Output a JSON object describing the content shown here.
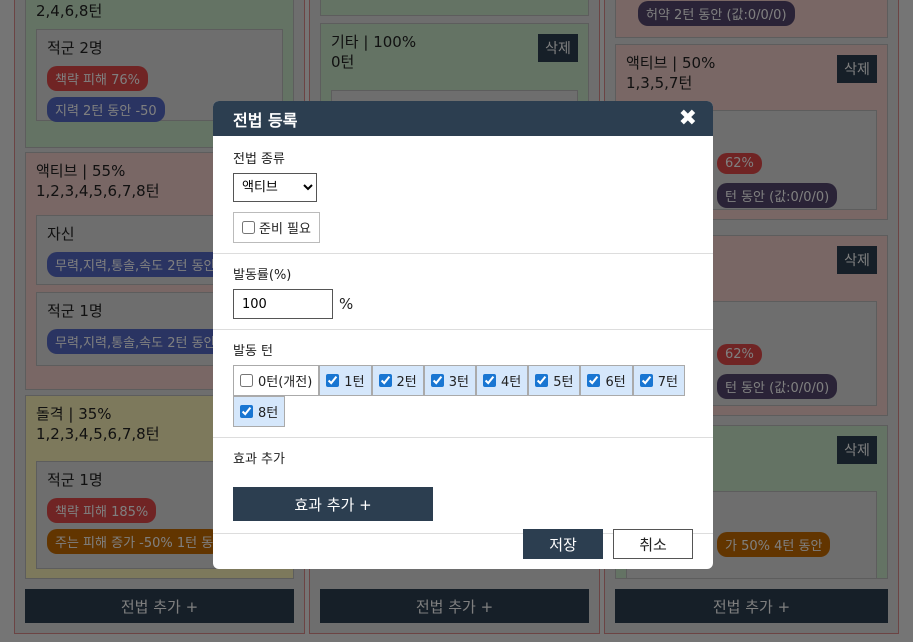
{
  "background": {
    "col1": {
      "tactic_top": {
        "turns": "2,4,6,8턴",
        "target_label": "적군 2명",
        "effects": [
          "책략 피해 76%",
          "지력 2턴 동안 -50"
        ]
      },
      "tactic_active": {
        "title": "액티브 | 55%",
        "turns": "1,2,3,4,5,6,7,8턴",
        "target1": "자신",
        "target1_effect": "무력,지력,통솔,속도 2턴 동안",
        "target2": "적군 1명",
        "target2_effect": "무력,지력,통솔,속도 2턴 동안"
      },
      "tactic_charge": {
        "title": "돌격 | 35%",
        "turns": "1,2,3,4,5,6,7,8턴",
        "target": "적군 1명",
        "effects": [
          "책략 피해 185%",
          "주는 피해 증가 -50% 1턴 동"
        ]
      }
    },
    "col2": {
      "tactic": {
        "title": "기타 | 100%",
        "turns": "0턴",
        "delete": "삭제"
      }
    },
    "col3": {
      "top_chip": "허약 2턴 동안 (값:0/0/0)",
      "tactic1": {
        "title": "액티브 | 50%",
        "turns": "1,3,5,7턴",
        "delete": "삭제",
        "chip1": "62%",
        "chip2": "턴 동안 (값:0/0/0)"
      },
      "tactic2": {
        "title": "",
        "delete": "삭제",
        "chip1": "62%",
        "chip2": "턴 동안 (값:0/0/0)"
      },
      "tactic3": {
        "delete": "삭제",
        "chip": "가 50% 4턴 동안"
      }
    },
    "add_tactic_label": "전법 추가 +"
  },
  "modal": {
    "title": "전법 등록",
    "close": "✖",
    "type_label": "전법 종류",
    "type_selected": "액티브",
    "ready_label": "준비 필요",
    "rate_label": "발동률(%)",
    "rate_value": "100",
    "rate_unit": "%",
    "turns_label": "발동 턴",
    "turns": [
      {
        "label": "0턴(개전)",
        "checked": false
      },
      {
        "label": "1턴",
        "checked": true
      },
      {
        "label": "2턴",
        "checked": true
      },
      {
        "label": "3턴",
        "checked": true
      },
      {
        "label": "4턴",
        "checked": true
      },
      {
        "label": "5턴",
        "checked": true
      },
      {
        "label": "6턴",
        "checked": true
      },
      {
        "label": "7턴",
        "checked": true
      },
      {
        "label": "8턴",
        "checked": true
      }
    ],
    "effect_label": "효과 추가",
    "add_effect": "효과 추가 +",
    "save": "저장",
    "cancel": "취소"
  }
}
